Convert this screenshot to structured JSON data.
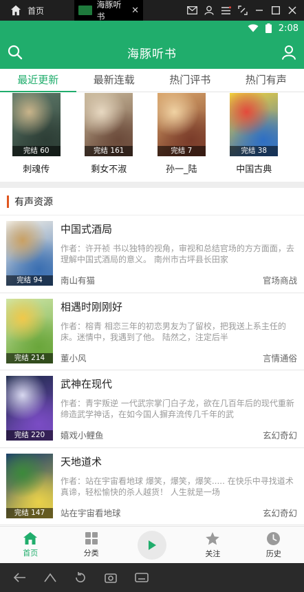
{
  "emulator": {
    "home_label": "首页",
    "tab_label": "海豚听书",
    "close_glyph": "✕"
  },
  "status_bar": {
    "time": "2:08"
  },
  "header": {
    "title": "海豚听书"
  },
  "tabs": [
    {
      "label": "最近更新",
      "active": true
    },
    {
      "label": "最新连载",
      "active": false
    },
    {
      "label": "热门评书",
      "active": false
    },
    {
      "label": "热门有声",
      "active": false
    }
  ],
  "featured": [
    {
      "name": "刺魂传",
      "badge": "完结 60",
      "palette": [
        "#5f7a6a",
        "#2d3e36",
        "#c9b48a"
      ]
    },
    {
      "name": "剩女不淑",
      "badge": "完结 161",
      "palette": [
        "#c8b89a",
        "#6b4a3a",
        "#e7d8c1"
      ]
    },
    {
      "name": "孙一_陆",
      "badge": "完结 7",
      "palette": [
        "#d9a56a",
        "#7a3c2a",
        "#f0d2a3"
      ]
    },
    {
      "name": "中国古典",
      "badge": "完结 38",
      "palette": [
        "#f2d23a",
        "#2e6fc4",
        "#e34a3c"
      ]
    }
  ],
  "section": {
    "title": "有声资源"
  },
  "books": [
    {
      "title": "中国式酒局",
      "desc": "作者：许开祯 书以独特的视角，审视和总结官场的方方面面，去理解中国式酒局的意义。 南州市古坪县长田家",
      "author": "南山有猫",
      "genre": "官场商战",
      "badge": "完结 94",
      "palette": [
        "#f3efe6",
        "#3b6fb1",
        "#c9a063"
      ]
    },
    {
      "title": "相遇时刚刚好",
      "desc": "作者：榕青 相恋三年的初恋男友为了留校，把我送上系主任的床。迷情中，我遇到了他。 陆然之，注定后半",
      "author": "董小风",
      "genre": "言情通俗",
      "badge": "完结 214",
      "palette": [
        "#cfe6a8",
        "#6aa63b",
        "#f0c84a"
      ]
    },
    {
      "title": "武神在现代",
      "desc": "作者：青宇叛逆 一代武宗掌门白子龙，欲在几百年后的现代重新缔造武学神话，在如今国人摒弃流传几千年的武",
      "author": "嬉戏小鲤鱼",
      "genre": "玄幻奇幻",
      "badge": "完结 220",
      "palette": [
        "#1e2a4a",
        "#7a4cc4",
        "#d8d8f0"
      ]
    },
    {
      "title": "天地道术",
      "desc": "作者：站在宇宙看地球 爆笑，爆笑，爆笑..... 在快乐中寻找道术真谛，轻松愉快的杀人越货！ 人生就是一场",
      "author": "站在宇宙看地球",
      "genre": "玄幻奇幻",
      "badge": "完结 147",
      "palette": [
        "#1a3f6b",
        "#e8d04a",
        "#3c8a3a"
      ]
    }
  ],
  "bottom_nav": [
    {
      "label": "首页",
      "icon": "home-icon",
      "active": true
    },
    {
      "label": "分类",
      "icon": "grid-icon",
      "active": false
    },
    {
      "label": "关注",
      "icon": "star-icon",
      "active": false
    },
    {
      "label": "历史",
      "icon": "clock-icon",
      "active": false
    }
  ],
  "colors": {
    "brand": "#20ad6c",
    "accent": "#e0561f"
  }
}
